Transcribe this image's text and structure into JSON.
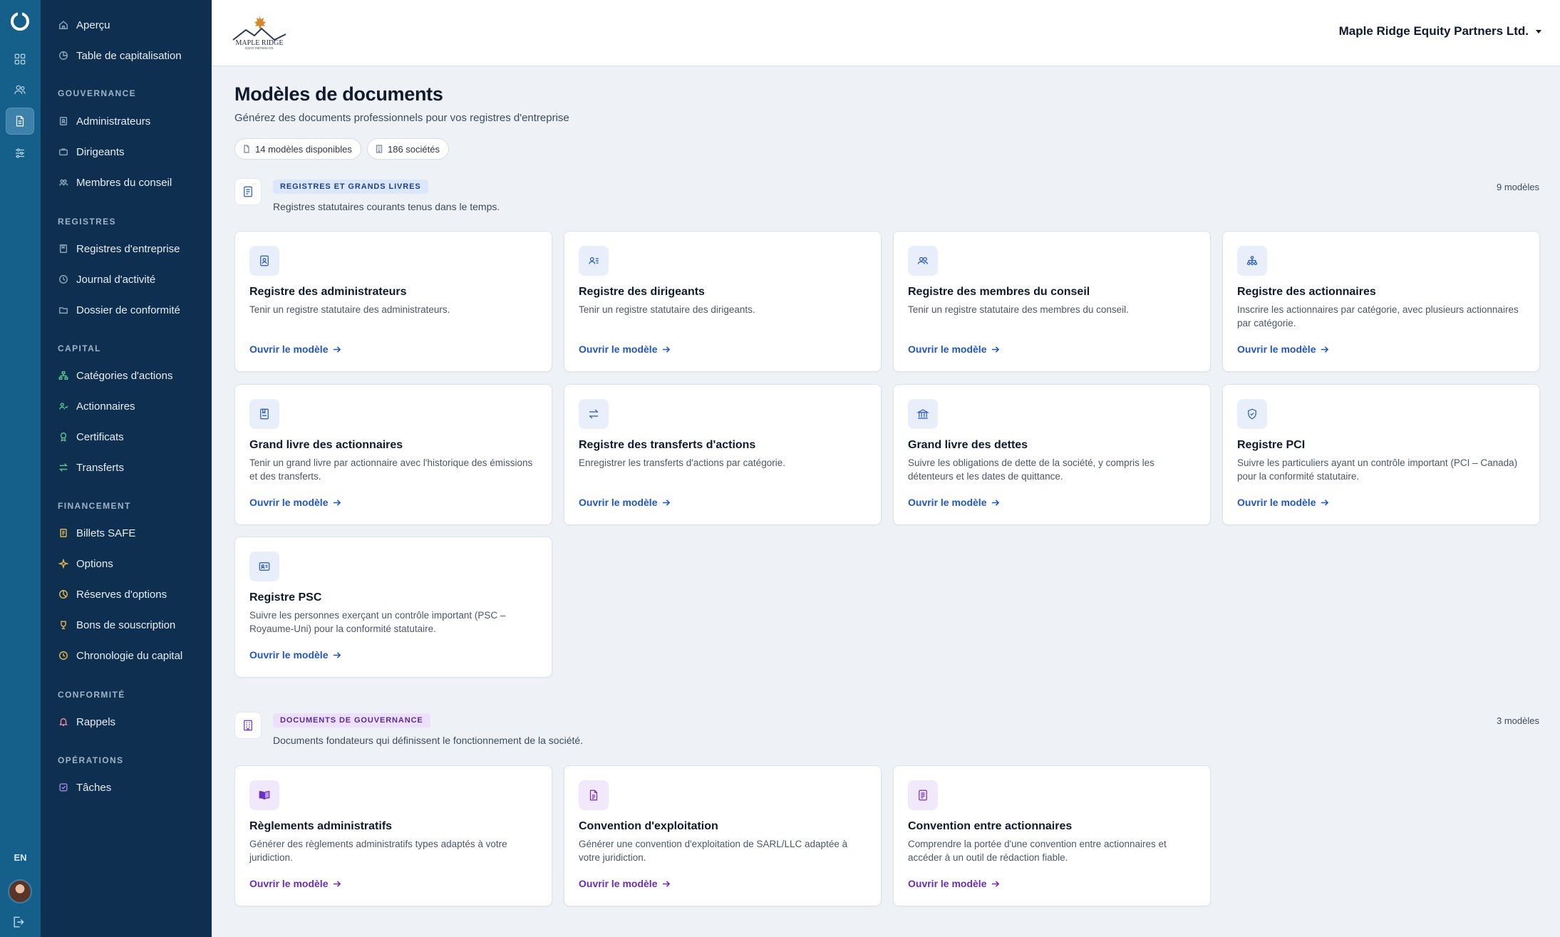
{
  "rail": {
    "logo_icon": "ring-logo-icon",
    "items": [
      {
        "icon": "grid-icon"
      },
      {
        "icon": "users-icon"
      },
      {
        "icon": "document-icon",
        "active": true
      },
      {
        "icon": "sliders-icon"
      }
    ],
    "language": "EN",
    "avatar_icon": "user-avatar",
    "logout_icon": "logout-icon"
  },
  "sidebar": {
    "top_items": [
      {
        "label": "Aperçu",
        "icon": "home-icon"
      },
      {
        "label": "Table de capitalisation",
        "icon": "pie-chart-icon"
      }
    ],
    "sections": [
      {
        "title": "GOUVERNANCE",
        "items": [
          {
            "label": "Administrateurs",
            "icon": "badge-icon"
          },
          {
            "label": "Dirigeants",
            "icon": "briefcase-icon"
          },
          {
            "label": "Membres du conseil",
            "icon": "group-icon"
          }
        ]
      },
      {
        "title": "REGISTRES",
        "items": [
          {
            "label": "Registres d'entreprise",
            "icon": "book-icon"
          },
          {
            "label": "Journal d'activité",
            "icon": "clock-icon"
          },
          {
            "label": "Dossier de conformité",
            "icon": "folder-icon"
          }
        ]
      },
      {
        "title": "CAPITAL",
        "items": [
          {
            "label": "Catégories d'actions",
            "icon": "hierarchy-icon"
          },
          {
            "label": "Actionnaires",
            "icon": "shareholders-icon"
          },
          {
            "label": "Certificats",
            "icon": "award-icon"
          },
          {
            "label": "Transferts",
            "icon": "transfer-icon"
          }
        ]
      },
      {
        "title": "FINANCEMENT",
        "items": [
          {
            "label": "Billets SAFE",
            "icon": "note-icon"
          },
          {
            "label": "Options",
            "icon": "sparkle-icon"
          },
          {
            "label": "Réserves d'options",
            "icon": "pie-icon"
          },
          {
            "label": "Bons de souscription",
            "icon": "trophy-icon"
          },
          {
            "label": "Chronologie du capital",
            "icon": "history-icon"
          }
        ]
      },
      {
        "title": "CONFORMITÉ",
        "items": [
          {
            "label": "Rappels",
            "icon": "bell-icon"
          }
        ]
      },
      {
        "title": "OPÉRATIONS",
        "items": [
          {
            "label": "Tâches",
            "icon": "checkbox-icon"
          }
        ]
      }
    ]
  },
  "header": {
    "logo_title": "MAPLE RIDGE",
    "logo_subtitle": "EQUITY PARTNERS LTD.",
    "company": "Maple Ridge Equity Partners Ltd."
  },
  "page": {
    "title": "Modèles de documents",
    "subtitle": "Générez des documents professionnels pour vos registres d'entreprise",
    "chips": [
      {
        "label": "14 modèles disponibles",
        "icon": "file-icon"
      },
      {
        "label": "186 sociétés",
        "icon": "building-icon"
      }
    ]
  },
  "colors": {
    "accent_blue": "#1f56c8",
    "accent_purple": "#6a2cc0",
    "sidebar_bg": "#0e2f4f",
    "rail_bg": "#14608a"
  },
  "sections": [
    {
      "tag": "REGISTRES ET GRANDS LIVRES",
      "description": "Registres statutaires courants tenus dans le temps.",
      "count": "9 modèles",
      "icon": "list-icon",
      "cards": [
        {
          "title": "Registre des administrateurs",
          "description": "Tenir un registre statutaire des administrateurs.",
          "link": "Ouvrir le modèle",
          "icon": "id-badge-icon"
        },
        {
          "title": "Registre des dirigeants",
          "description": "Tenir un registre statutaire des dirigeants.",
          "link": "Ouvrir le modèle",
          "icon": "user-list-icon"
        },
        {
          "title": "Registre des membres du conseil",
          "description": "Tenir un registre statutaire des membres du conseil.",
          "link": "Ouvrir le modèle",
          "icon": "users-icon"
        },
        {
          "title": "Registre des actionnaires",
          "description": "Inscrire les actionnaires par catégorie, avec plusieurs actionnaires par catégorie.",
          "link": "Ouvrir le modèle",
          "icon": "network-icon"
        },
        {
          "title": "Grand livre des actionnaires",
          "description": "Tenir un grand livre par actionnaire avec l'historique des émissions et des transferts.",
          "link": "Ouvrir le modèle",
          "icon": "ledger-book-icon"
        },
        {
          "title": "Registre des transferts d'actions",
          "description": "Enregistrer les transferts d'actions par catégorie.",
          "link": "Ouvrir le modèle",
          "icon": "arrows-exchange-icon"
        },
        {
          "title": "Grand livre des dettes",
          "description": "Suivre les obligations de dette de la société, y compris les détenteurs et les dates de quittance.",
          "link": "Ouvrir le modèle",
          "icon": "bank-icon"
        },
        {
          "title": "Registre PCI",
          "description": "Suivre les particuliers ayant un contrôle important (PCI – Canada) pour la conformité statutaire.",
          "link": "Ouvrir le modèle",
          "icon": "shield-check-icon"
        },
        {
          "title": "Registre PSC",
          "description": "Suivre les personnes exerçant un contrôle important (PSC – Royaume-Uni) pour la conformité statutaire.",
          "link": "Ouvrir le modèle",
          "icon": "id-card-icon"
        }
      ]
    },
    {
      "tag": "DOCUMENTS DE GOUVERNANCE",
      "description": "Documents fondateurs qui définissent le fonctionnement de la société.",
      "count": "3 modèles",
      "icon": "building-icon",
      "cards": [
        {
          "title": "Règlements administratifs",
          "description": "Générer des règlements administratifs types adaptés à votre juridiction.",
          "link": "Ouvrir le modèle",
          "icon": "open-book-icon"
        },
        {
          "title": "Convention d'exploitation",
          "description": "Générer une convention d'exploitation de SARL/LLC adaptée à votre juridiction.",
          "link": "Ouvrir le modèle",
          "icon": "file-text-icon"
        },
        {
          "title": "Convention entre actionnaires",
          "description": "Comprendre la portée d'une convention entre actionnaires et accéder à un outil de rédaction fiable.",
          "link": "Ouvrir le modèle",
          "icon": "document-lines-icon"
        }
      ]
    }
  ]
}
